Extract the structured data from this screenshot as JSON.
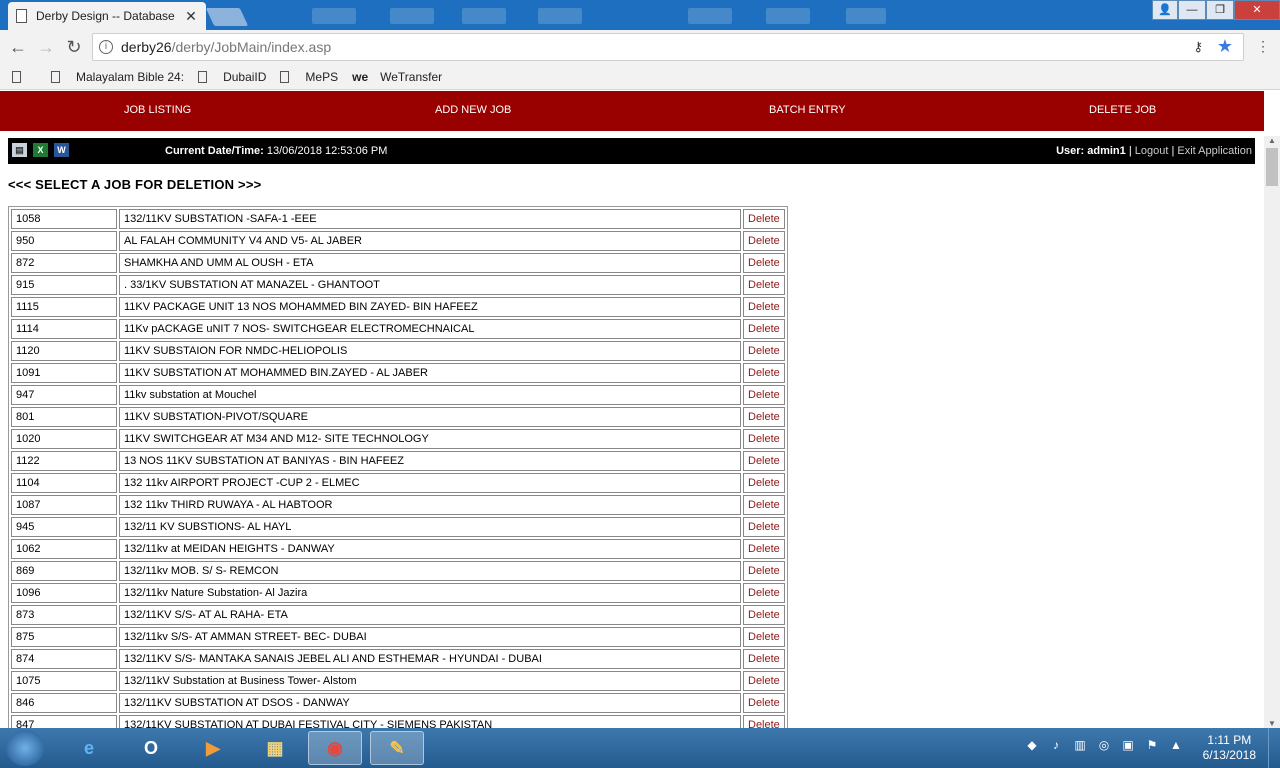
{
  "browser": {
    "tab_title": "Derby Design -- Database",
    "tab_close": "✕",
    "url_host": "derby26",
    "url_path": "/derby/JobMain/index.asp",
    "bookmarks": [
      {
        "label": "Malayalam Bible 24:"
      },
      {
        "label": "DubaiID"
      },
      {
        "label": "MePS"
      },
      {
        "label": "WeTransfer",
        "icon_text": "we"
      }
    ]
  },
  "nav": {
    "items": [
      "JOB LISTING",
      "ADD NEW JOB",
      "BATCH ENTRY",
      "DELETE JOB"
    ]
  },
  "infobar": {
    "datetime_label": "Current Date/Time:",
    "datetime_value": "13/06/2018 12:53:06 PM",
    "user_label": "User:",
    "user_name": "admin1",
    "logout": "Logout",
    "exit": "Exit Application",
    "separator": "|"
  },
  "heading": "<<< SELECT A JOB FOR DELETION >>>",
  "delete_label": "Delete",
  "jobs": [
    {
      "id": "1058",
      "name": "132/11KV SUBSTATION -SAFA-1 -EEE"
    },
    {
      "id": "950",
      "name": "AL FALAH COMMUNITY V4 AND V5- AL JABER"
    },
    {
      "id": "872",
      "name": "SHAMKHA AND UMM AL OUSH - ETA"
    },
    {
      "id": "915",
      "name": ". 33/1KV SUBSTATION AT MANAZEL - GHANTOOT"
    },
    {
      "id": "1115",
      "name": "11KV PACKAGE UNIT 13 NOS MOHAMMED BIN ZAYED- BIN HAFEEZ"
    },
    {
      "id": "1114",
      "name": "11Kv pACKAGE uNIT 7 NOS- SWITCHGEAR ELECTROMECHNAICAL"
    },
    {
      "id": "1120",
      "name": "11KV SUBSTAION FOR NMDC-HELIOPOLIS"
    },
    {
      "id": "1091",
      "name": "11KV SUBSTATION AT MOHAMMED BIN.ZAYED - AL JABER"
    },
    {
      "id": "947",
      "name": "11kv substation at Mouchel"
    },
    {
      "id": "801",
      "name": "11KV SUBSTATION-PIVOT/SQUARE"
    },
    {
      "id": "1020",
      "name": "11KV SWITCHGEAR AT M34 AND M12- SITE TECHNOLOGY"
    },
    {
      "id": "1122",
      "name": "13 NOS 11KV SUBSTATION AT BANIYAS - BIN HAFEEZ"
    },
    {
      "id": "1104",
      "name": "132 11kv AIRPORT PROJECT -CUP 2 - ELMEC"
    },
    {
      "id": "1087",
      "name": "132 11kv THIRD RUWAYA - AL HABTOOR"
    },
    {
      "id": "945",
      "name": "132/11 KV SUBSTIONS- AL HAYL"
    },
    {
      "id": "1062",
      "name": "132/11kv at MEIDAN HEIGHTS - DANWAY"
    },
    {
      "id": "869",
      "name": "132/11kv MOB. S/ S- REMCON"
    },
    {
      "id": "1096",
      "name": "132/11kv Nature Substation- Al Jazira"
    },
    {
      "id": "873",
      "name": "132/11KV S/S- AT AL RAHA- ETA"
    },
    {
      "id": "875",
      "name": "132/11kv S/S- AT AMMAN STREET- BEC- DUBAI"
    },
    {
      "id": "874",
      "name": "132/11KV S/S- MANTAKA SANAIS JEBEL ALI AND ESTHEMAR - HYUNDAI - DUBAI"
    },
    {
      "id": "1075",
      "name": "132/11kV Substation at Business Tower- Alstom"
    },
    {
      "id": "846",
      "name": "132/11KV SUBSTATION AT DSOS - DANWAY"
    },
    {
      "id": "847",
      "name": "132/11KV SUBSTATION AT DUBAI FESTIVAL CITY - SIEMENS PAKISTAN"
    }
  ],
  "taskbar": {
    "time": "1:11 PM",
    "date": "6/13/2018"
  }
}
